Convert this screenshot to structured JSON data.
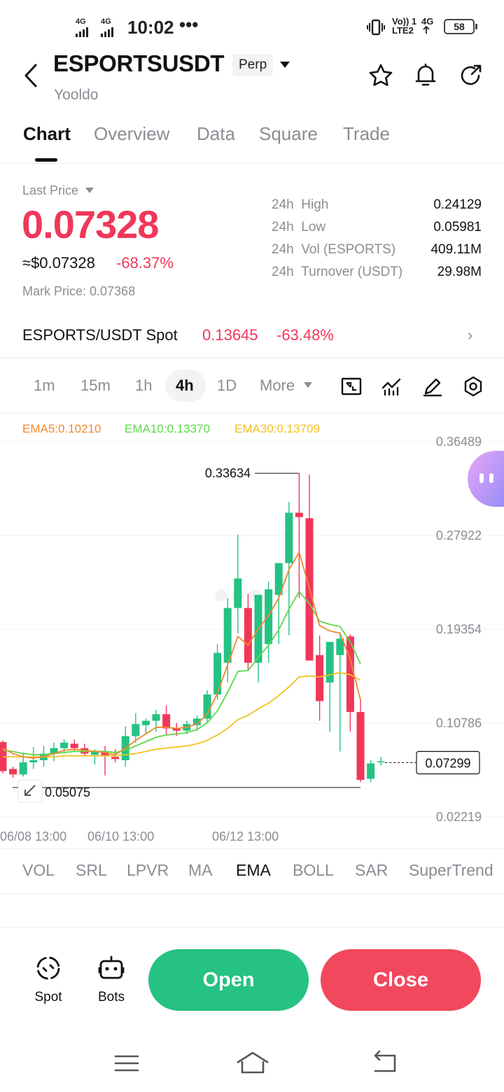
{
  "status_bar": {
    "net1": "4G",
    "net2": "4G",
    "time": "10:02",
    "dots": "•••",
    "volte": "Vo)) 1",
    "lte": "LTE2",
    "net3": "4G",
    "battery": "58"
  },
  "header": {
    "title": "ESPORTSUSDT",
    "badge": "Perp",
    "subtitle": "Yooldo"
  },
  "tabs": [
    "Chart",
    "Overview",
    "Data",
    "Square",
    "Trade"
  ],
  "price": {
    "last_price_label": "Last Price",
    "last_price": "0.07328",
    "usd_value": "≈$0.07328",
    "change": "-68.37%",
    "mark_price": "Mark Price: 0.07368"
  },
  "stats": [
    {
      "period": "24h",
      "label": "High",
      "value": "0.24129"
    },
    {
      "period": "24h",
      "label": "Low",
      "value": "0.05981"
    },
    {
      "period": "24h",
      "label": "Vol (ESPORTS)",
      "value": "409.11M"
    },
    {
      "period": "24h",
      "label": "Turnover (USDT)",
      "value": "29.98M"
    }
  ],
  "spot": {
    "name": "ESPORTS/USDT Spot",
    "price": "0.13645",
    "change": "-63.48%",
    "arrow": "›"
  },
  "intervals": [
    "1m",
    "15m",
    "1h",
    "4h",
    "1D",
    "More"
  ],
  "ema_labels": {
    "ema5": "EMA5:0.10210",
    "ema10": "EMA10:0.13370",
    "ema30": "EMA30:0.13709"
  },
  "colors": {
    "up": "#25c283",
    "down": "#f0375a",
    "ema5": "#f0892d",
    "ema10": "#5fd84c",
    "ema30": "#f2c11e"
  },
  "chart_data": {
    "type": "candlestick",
    "y_ticks": [
      "0.36489",
      "0.27922",
      "0.19354",
      "0.10786",
      "0.02219"
    ],
    "ylim": [
      0.02219,
      0.36489
    ],
    "x_labels": [
      "06/08 13:00",
      "06/10 13:00",
      "06/12 13:00"
    ],
    "max_label": "0.33634",
    "min_label": "0.05075",
    "current_price_label": "0.07299",
    "candles": [
      {
        "o": 0.0905,
        "h": 0.092,
        "l": 0.062,
        "c": 0.064
      },
      {
        "o": 0.066,
        "h": 0.068,
        "l": 0.058,
        "c": 0.061
      },
      {
        "o": 0.061,
        "h": 0.081,
        "l": 0.059,
        "c": 0.072
      },
      {
        "o": 0.072,
        "h": 0.086,
        "l": 0.066,
        "c": 0.074
      },
      {
        "o": 0.074,
        "h": 0.087,
        "l": 0.068,
        "c": 0.08
      },
      {
        "o": 0.08,
        "h": 0.09,
        "l": 0.073,
        "c": 0.085
      },
      {
        "o": 0.085,
        "h": 0.093,
        "l": 0.08,
        "c": 0.09
      },
      {
        "o": 0.089,
        "h": 0.093,
        "l": 0.082,
        "c": 0.085
      },
      {
        "o": 0.085,
        "h": 0.089,
        "l": 0.078,
        "c": 0.08
      },
      {
        "o": 0.079,
        "h": 0.084,
        "l": 0.07,
        "c": 0.082
      },
      {
        "o": 0.082,
        "h": 0.087,
        "l": 0.06,
        "c": 0.078
      },
      {
        "o": 0.077,
        "h": 0.084,
        "l": 0.072,
        "c": 0.075
      },
      {
        "o": 0.074,
        "h": 0.105,
        "l": 0.068,
        "c": 0.096
      },
      {
        "o": 0.096,
        "h": 0.117,
        "l": 0.09,
        "c": 0.107
      },
      {
        "o": 0.106,
        "h": 0.112,
        "l": 0.098,
        "c": 0.11
      },
      {
        "o": 0.11,
        "h": 0.12,
        "l": 0.1,
        "c": 0.116
      },
      {
        "o": 0.116,
        "h": 0.124,
        "l": 0.097,
        "c": 0.103
      },
      {
        "o": 0.103,
        "h": 0.108,
        "l": 0.096,
        "c": 0.101
      },
      {
        "o": 0.101,
        "h": 0.11,
        "l": 0.098,
        "c": 0.107
      },
      {
        "o": 0.106,
        "h": 0.115,
        "l": 0.101,
        "c": 0.112
      },
      {
        "o": 0.112,
        "h": 0.138,
        "l": 0.108,
        "c": 0.134
      },
      {
        "o": 0.134,
        "h": 0.18,
        "l": 0.129,
        "c": 0.172
      },
      {
        "o": 0.163,
        "h": 0.222,
        "l": 0.145,
        "c": 0.213
      },
      {
        "o": 0.213,
        "h": 0.28,
        "l": 0.19,
        "c": 0.24
      },
      {
        "o": 0.213,
        "h": 0.226,
        "l": 0.157,
        "c": 0.163
      },
      {
        "o": 0.163,
        "h": 0.224,
        "l": 0.145,
        "c": 0.225
      },
      {
        "o": 0.18,
        "h": 0.237,
        "l": 0.163,
        "c": 0.23
      },
      {
        "o": 0.225,
        "h": 0.247,
        "l": 0.18,
        "c": 0.254
      },
      {
        "o": 0.254,
        "h": 0.31,
        "l": 0.188,
        "c": 0.3
      },
      {
        "o": 0.3,
        "h": 0.336,
        "l": 0.222,
        "c": 0.296
      },
      {
        "o": 0.295,
        "h": 0.335,
        "l": 0.202,
        "c": 0.165
      },
      {
        "o": 0.17,
        "h": 0.188,
        "l": 0.11,
        "c": 0.128
      },
      {
        "o": 0.145,
        "h": 0.164,
        "l": 0.1,
        "c": 0.182
      },
      {
        "o": 0.17,
        "h": 0.191,
        "l": 0.082,
        "c": 0.185
      },
      {
        "o": 0.187,
        "h": 0.189,
        "l": 0.1,
        "c": 0.118
      },
      {
        "o": 0.118,
        "h": 0.13,
        "l": 0.054,
        "c": 0.056
      },
      {
        "o": 0.057,
        "h": 0.074,
        "l": 0.054,
        "c": 0.071
      },
      {
        "o": 0.073,
        "h": 0.077,
        "l": 0.069,
        "c": 0.073
      }
    ],
    "ema5": [
      0.085,
      0.08,
      0.077,
      0.076,
      0.077,
      0.08,
      0.083,
      0.084,
      0.083,
      0.082,
      0.081,
      0.079,
      0.085,
      0.092,
      0.098,
      0.104,
      0.104,
      0.103,
      0.104,
      0.107,
      0.116,
      0.135,
      0.161,
      0.187,
      0.179,
      0.194,
      0.206,
      0.222,
      0.248,
      0.264,
      0.231,
      0.197,
      0.192,
      0.19,
      0.166,
      0.129
    ],
    "ema10": [
      0.083,
      0.082,
      0.08,
      0.079,
      0.079,
      0.08,
      0.081,
      0.082,
      0.082,
      0.082,
      0.082,
      0.081,
      0.083,
      0.087,
      0.091,
      0.095,
      0.097,
      0.098,
      0.099,
      0.102,
      0.108,
      0.119,
      0.136,
      0.155,
      0.156,
      0.168,
      0.179,
      0.193,
      0.212,
      0.228,
      0.217,
      0.201,
      0.198,
      0.196,
      0.182,
      0.162
    ],
    "ema30": [
      0.077,
      0.077,
      0.077,
      0.077,
      0.077,
      0.077,
      0.078,
      0.078,
      0.078,
      0.078,
      0.078,
      0.078,
      0.079,
      0.08,
      0.082,
      0.084,
      0.085,
      0.086,
      0.087,
      0.089,
      0.092,
      0.097,
      0.103,
      0.111,
      0.115,
      0.121,
      0.126,
      0.133,
      0.141,
      0.15,
      0.151,
      0.15,
      0.152,
      0.154,
      0.152,
      0.147
    ]
  },
  "indicators": [
    "VOL",
    "SRL",
    "LPVR",
    "MA",
    "EMA",
    "BOLL",
    "SAR",
    "SuperTrend"
  ],
  "bottom": {
    "spot_label": "Spot",
    "bots_label": "Bots",
    "open_label": "Open",
    "close_label": "Close"
  }
}
